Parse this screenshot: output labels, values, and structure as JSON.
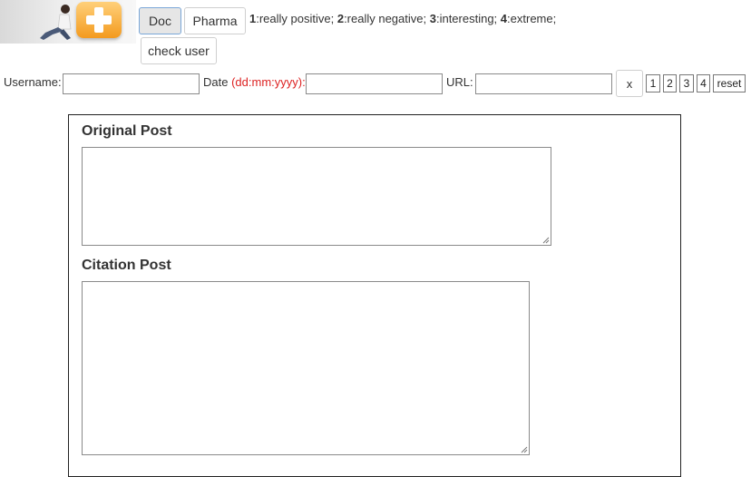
{
  "toolbar": {
    "doc_label": "Doc",
    "pharma_label": "Pharma",
    "check_user_label": "check user",
    "legend": [
      {
        "num": "1",
        "text": ":really positive; "
      },
      {
        "num": "2",
        "text": ":really negative; "
      },
      {
        "num": "3",
        "text": ":interesting; "
      },
      {
        "num": "4",
        "text": ":extreme;"
      }
    ]
  },
  "filters": {
    "username_label": "Username:",
    "date_label": "Date",
    "date_format": "(dd:mm:yyyy):",
    "url_label": "URL:",
    "clear_label": "x",
    "rating_buttons": [
      "1",
      "2",
      "3",
      "4"
    ],
    "reset_label": "reset",
    "username_value": "",
    "date_value": "",
    "url_value": ""
  },
  "form": {
    "original_post_heading": "Original Post",
    "citation_post_heading": "Citation Post",
    "original_post_value": "",
    "citation_post_value": ""
  },
  "colors": {
    "accent_red": "#dd2222",
    "active_button_border": "#7aa7d8",
    "logo_orange": "#f39a1e"
  }
}
